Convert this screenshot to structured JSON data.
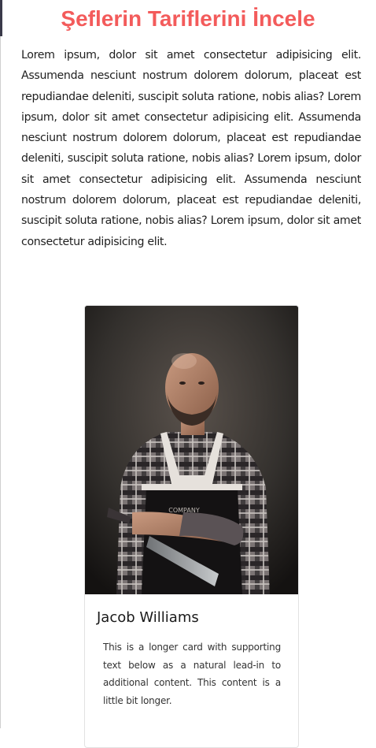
{
  "header": {
    "title": "Şeflerin Tariflerini İncele"
  },
  "intro": {
    "paragraph": "Lorem ipsum, dolor sit amet consectetur adipisicing elit. Assumenda nesciunt nostrum dolorem dolorum, placeat est repudiandae deleniti, suscipit soluta ratione, nobis alias? Lorem ipsum, dolor sit amet consectetur adipisicing elit. Assumenda nesciunt nostrum dolorem dolorum, placeat est repudiandae deleniti, suscipit soluta ratione, nobis alias? Lorem ipsum, dolor sit amet consectetur adipisicing elit. Assumenda nesciunt nostrum dolorem dolorum, placeat est repudiandae deleniti, suscipit soluta ratione, nobis alias? Lorem ipsum, dolor sit amet consectetur adipisicing elit."
  },
  "chef_card": {
    "name": "Jacob Williams",
    "text": "This is a longer card with supporting text below as a natural lead-in to additional content. This content is a little bit longer."
  },
  "colors": {
    "title": "#f35b5b",
    "background": "#ffffff",
    "card_border": "#e2e2e2"
  }
}
